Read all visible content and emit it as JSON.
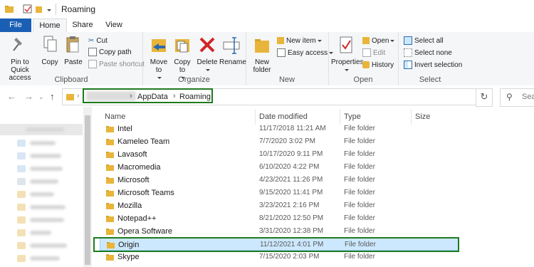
{
  "window": {
    "title": "Roaming"
  },
  "tabs": {
    "file": "File",
    "home": "Home",
    "share": "Share",
    "view": "View"
  },
  "ribbon": {
    "clipboard": {
      "label": "Clipboard",
      "pin": "Pin to Quick access",
      "copy": "Copy",
      "paste": "Paste",
      "cut": "Cut",
      "copy_path": "Copy path",
      "paste_shortcut": "Paste shortcut"
    },
    "organize": {
      "label": "Organize",
      "move_to": "Move to",
      "copy_to": "Copy to",
      "delete": "Delete",
      "rename": "Rename"
    },
    "new": {
      "label": "New",
      "new_folder": "New folder",
      "new_item": "New item",
      "easy_access": "Easy access"
    },
    "open": {
      "label": "Open",
      "properties": "Properties",
      "open": "Open",
      "edit": "Edit",
      "history": "History"
    },
    "select": {
      "label": "Select",
      "select_all": "Select all",
      "select_none": "Select none",
      "invert": "Invert selection"
    }
  },
  "address": {
    "crumbs": [
      "AppData",
      "Roaming"
    ],
    "search_placeholder": "Sea"
  },
  "columns": {
    "name": "Name",
    "date": "Date modified",
    "type": "Type",
    "size": "Size"
  },
  "files": [
    {
      "name": "Intel",
      "date": "11/17/2018 11:21 AM",
      "type": "File folder"
    },
    {
      "name": "Kameleo Team",
      "date": "7/7/2020 3:02 PM",
      "type": "File folder"
    },
    {
      "name": "Lavasoft",
      "date": "10/17/2020 9:11 PM",
      "type": "File folder"
    },
    {
      "name": "Macromedia",
      "date": "6/10/2020 4:22 PM",
      "type": "File folder"
    },
    {
      "name": "Microsoft",
      "date": "4/23/2021 11:26 PM",
      "type": "File folder"
    },
    {
      "name": "Microsoft Teams",
      "date": "9/15/2020 11:41 PM",
      "type": "File folder"
    },
    {
      "name": "Mozilla",
      "date": "3/23/2021 2:16 PM",
      "type": "File folder"
    },
    {
      "name": "Notepad++",
      "date": "8/21/2020 12:50 PM",
      "type": "File folder"
    },
    {
      "name": "Opera Software",
      "date": "3/31/2020 12:38 PM",
      "type": "File folder"
    },
    {
      "name": "Origin",
      "date": "11/12/2021 4:01 PM",
      "type": "File folder"
    },
    {
      "name": "Skype",
      "date": "7/15/2020 2:03 PM",
      "type": "File folder"
    }
  ],
  "colors": {
    "accent": "#1a5fb4",
    "highlight": "#1e7b1e",
    "selection": "#cce8ff",
    "folder": "#e8b53a"
  }
}
